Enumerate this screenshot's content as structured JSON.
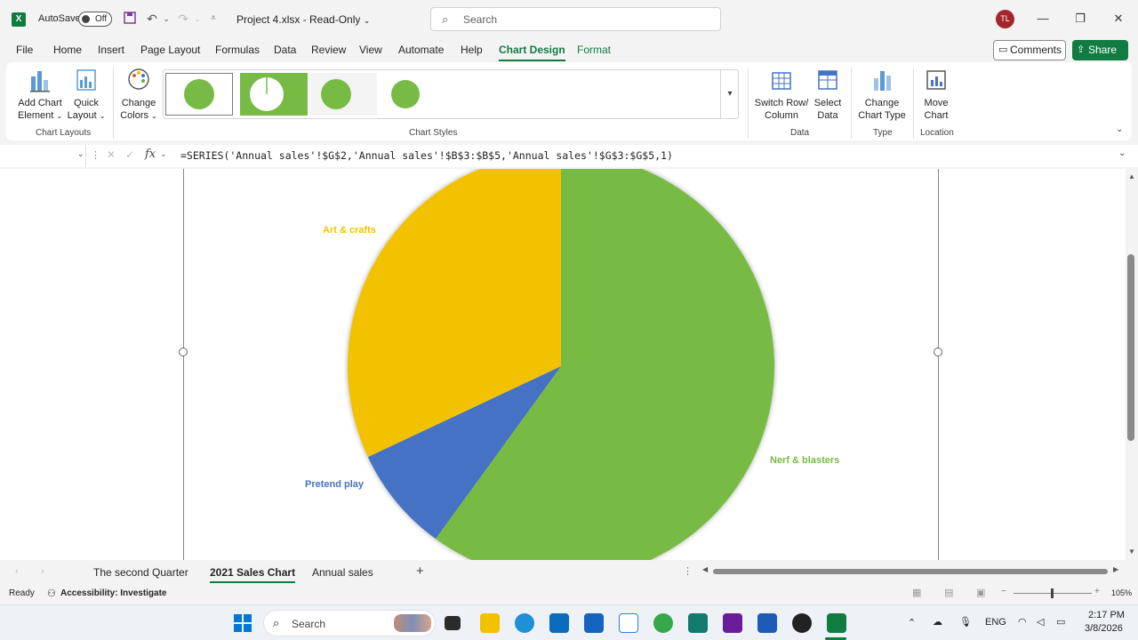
{
  "window": {
    "autosave_label": "AutoSave",
    "autosave_state": "Off",
    "doc_title": "Project 4.xlsx  -  Read-Only",
    "search_placeholder": "Search",
    "user_initials": "TL"
  },
  "ribbon_tabs": [
    "File",
    "Home",
    "Insert",
    "Page Layout",
    "Formulas",
    "Data",
    "Review",
    "View",
    "Automate",
    "Help",
    "Chart Design",
    "Format"
  ],
  "active_tab": "Chart Design",
  "comments_label": "Comments",
  "share_label": "Share",
  "ribbon": {
    "add_chart_element": [
      "Add Chart",
      "Element"
    ],
    "quick_layout": [
      "Quick",
      "Layout"
    ],
    "chart_layouts_label": "Chart Layouts",
    "change_colors": [
      "Change",
      "Colors"
    ],
    "chart_styles_label": "Chart Styles",
    "switch_row_col": [
      "Switch Row/",
      "Column"
    ],
    "select_data": [
      "Select",
      "Data"
    ],
    "data_label": "Data",
    "change_chart_type": [
      "Change",
      "Chart Type"
    ],
    "type_label": "Type",
    "move_chart": [
      "Move",
      "Chart"
    ],
    "location_label": "Location"
  },
  "formula_bar": {
    "fx": "fx",
    "formula": "=SERIES('Annual sales'!$G$2,'Annual sales'!$B$3:$B$5,'Annual sales'!$G$3:$G$5,1)"
  },
  "chart_data": {
    "type": "pie",
    "categories": [
      "Nerf & blasters",
      "Pretend play",
      "Art & crafts"
    ],
    "values": [
      0.6,
      0.08,
      0.32
    ],
    "colors": [
      "#77bb44",
      "#4472c4",
      "#f2c200"
    ],
    "title": "",
    "start_angle_deg": 0
  },
  "sheet_tabs": [
    "The second Quarter",
    "2021 Sales Chart",
    "Annual sales"
  ],
  "active_sheet": "2021 Sales Chart",
  "status": {
    "ready": "Ready",
    "accessibility": "Accessibility: Investigate",
    "zoom": "105%"
  },
  "taskbar": {
    "search_placeholder": "Search",
    "language": "ENG",
    "time": "2:17 PM",
    "date": "3/8/2026"
  }
}
